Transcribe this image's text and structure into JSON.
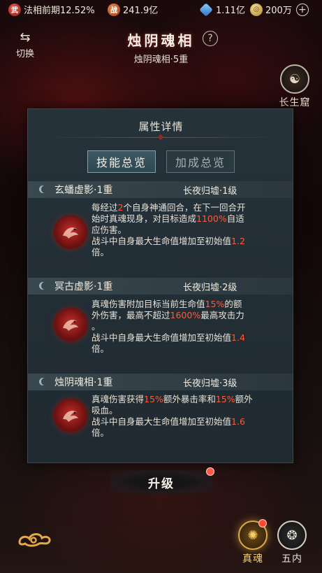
{
  "status_bar": {
    "realm_icon": "武",
    "realm": "法相前期12.52%",
    "combat_icon": "战",
    "combat_power": "241.9亿",
    "gems": "1.11亿",
    "coins": "200万",
    "plus_label": "+"
  },
  "header": {
    "switch_label": "切换",
    "title": "烛阴魂相",
    "help_label": "?",
    "subtitle": "烛阴魂相·5重",
    "cave_label": "长生窟"
  },
  "panel": {
    "title": "属性详情",
    "tabs": [
      {
        "label": "技能总览",
        "active": true
      },
      {
        "label": "加成总览",
        "active": false
      }
    ],
    "skills": [
      {
        "name": "玄蟠虚影·1重",
        "requirement": "长夜归墟·1级",
        "desc_lines": [
          [
            {
              "t": "每经过"
            },
            {
              "t": "2",
              "hl": true
            },
            {
              "t": "个自身神通回合，在下一回合开"
            }
          ],
          [
            {
              "t": "始时真魂现身，对目标造成"
            },
            {
              "t": "1100%",
              "hl": true
            },
            {
              "t": "自适"
            }
          ],
          [
            {
              "t": "应伤害。"
            }
          ],
          [
            {
              "t": "战斗中自身最大生命值增加至初始值"
            },
            {
              "t": "1.2",
              "hl": true
            }
          ],
          [
            {
              "t": "倍。"
            }
          ]
        ]
      },
      {
        "name": "冥古虚影·1重",
        "requirement": "长夜归墟·2级",
        "desc_lines": [
          [
            {
              "t": "真魂伤害附加目标当前生命值"
            },
            {
              "t": "15%",
              "hl": true
            },
            {
              "t": "的额"
            }
          ],
          [
            {
              "t": "外伤害，最高不超过"
            },
            {
              "t": "1600%",
              "hl": true
            },
            {
              "t": "最高攻击力"
            }
          ],
          [
            {
              "t": "。"
            }
          ],
          [
            {
              "t": "战斗中自身最大生命值增加至初始值"
            },
            {
              "t": "1.4",
              "hl": true
            }
          ],
          [
            {
              "t": "倍。"
            }
          ]
        ]
      },
      {
        "name": "烛阴魂相·1重",
        "requirement": "长夜归墟·3级",
        "desc_lines": [
          [
            {
              "t": "真魂伤害获得"
            },
            {
              "t": "15%",
              "hl": true
            },
            {
              "t": "额外暴击率和"
            },
            {
              "t": "15%",
              "hl": true
            },
            {
              "t": "额外"
            }
          ],
          [
            {
              "t": "吸血。"
            }
          ],
          [
            {
              "t": "战斗中自身最大生命值增加至初始值"
            },
            {
              "t": "1.6",
              "hl": true
            }
          ],
          [
            {
              "t": "倍。"
            }
          ]
        ]
      }
    ]
  },
  "bottom": {
    "upgrade_label": "升级",
    "soul_label": "真魂",
    "inner_label": "五内"
  },
  "colors": {
    "highlight": "#ff5a3a",
    "panel_bg": "#26323a",
    "badge": "#ff5a40"
  }
}
